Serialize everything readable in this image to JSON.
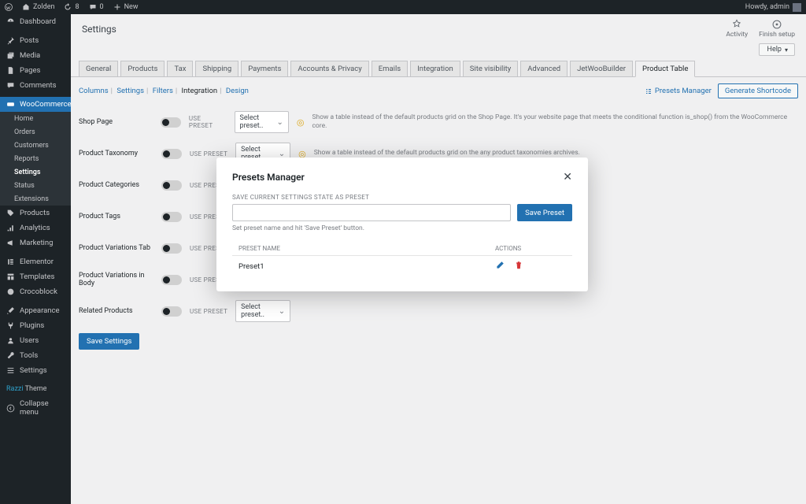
{
  "adminbar": {
    "site": "Zolden",
    "updates": "8",
    "comments": "0",
    "new": "New",
    "howdy": "Howdy, admin"
  },
  "sidebar": {
    "items": [
      {
        "label": "Dashboard"
      },
      {
        "label": "Posts"
      },
      {
        "label": "Media"
      },
      {
        "label": "Pages"
      },
      {
        "label": "Comments"
      }
    ],
    "woo": "WooCommerce",
    "woo_sub": [
      "Home",
      "Orders",
      "Customers",
      "Reports",
      "Settings",
      "Status",
      "Extensions"
    ],
    "woo_current": "Settings",
    "items2": [
      {
        "label": "Products"
      },
      {
        "label": "Analytics"
      },
      {
        "label": "Marketing"
      }
    ],
    "items3": [
      {
        "label": "Elementor"
      },
      {
        "label": "Templates"
      },
      {
        "label": "Crocoblock"
      }
    ],
    "items4": [
      {
        "label": "Appearance"
      },
      {
        "label": "Plugins"
      },
      {
        "label": "Users"
      },
      {
        "label": "Tools"
      },
      {
        "label": "Settings"
      }
    ],
    "theme_brand": "Razzi",
    "theme_label": "Theme",
    "collapse": "Collapse menu"
  },
  "page": {
    "title": "Settings",
    "activity": "Activity",
    "finish": "Finish setup",
    "help": "Help"
  },
  "tabs": [
    "General",
    "Products",
    "Tax",
    "Shipping",
    "Payments",
    "Accounts & Privacy",
    "Emails",
    "Integration",
    "Site visibility",
    "Advanced",
    "JetWooBuilder",
    "Product Table"
  ],
  "active_tab": "Product Table",
  "subnav": {
    "columns": "Columns",
    "settings": "Settings",
    "filters": "Filters",
    "integration": "Integration",
    "design": "Design"
  },
  "row_buttons": {
    "presets": "Presets Manager",
    "generate": "Generate Shortcode"
  },
  "use_preset_label": "USE PRESET",
  "select_placeholder": "Select preset..",
  "rows": [
    {
      "label": "Shop Page",
      "hint": "Show a table instead of the default products grid on the Shop Page. It's your website page that meets the conditional function is_shop() from the WooCommerce core."
    },
    {
      "label": "Product Taxonomy",
      "hint": "Show a table instead of the default products grid on the any product taxonomies archives."
    },
    {
      "label": "Product Categories",
      "hint": ""
    },
    {
      "label": "Product Tags",
      "hint": ""
    },
    {
      "label": "Product Variations Tab",
      "hint": ""
    },
    {
      "label": "Product Variations in Body",
      "hint": ""
    },
    {
      "label": "Related Products",
      "hint": ""
    }
  ],
  "save_settings": "Save Settings",
  "modal": {
    "title": "Presets Manager",
    "save_label": "SAVE CURRENT SETTINGS STATE AS PRESET",
    "save_btn": "Save Preset",
    "help": "Set preset name and hit 'Save Preset' button.",
    "col_name": "PRESET NAME",
    "col_actions": "ACTIONS",
    "presets": [
      {
        "name": "Preset1"
      }
    ]
  }
}
